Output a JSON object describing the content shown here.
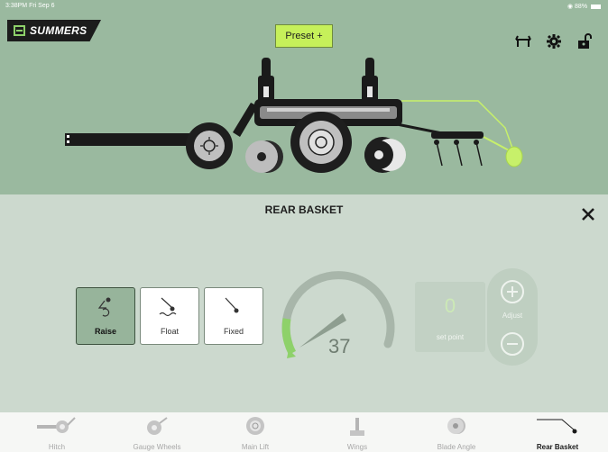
{
  "status_bar": {
    "time": "3:38PM  Fri Sep 6",
    "battery": "88%"
  },
  "header": {
    "brand": "SUMMERS",
    "preset_label": "Preset +"
  },
  "panel": {
    "title": "REAR BASKET",
    "modes": [
      {
        "label": "Raise",
        "active": true
      },
      {
        "label": "Float",
        "active": false
      },
      {
        "label": "Fixed",
        "active": false
      }
    ],
    "gauge_value": "37",
    "set_point_value": "0",
    "set_point_label": "set point",
    "adjust_label": "Adjust"
  },
  "nav": {
    "items": [
      {
        "label": "Hitch",
        "active": false
      },
      {
        "label": "Gauge Wheels",
        "active": false
      },
      {
        "label": "Main Lift",
        "active": false
      },
      {
        "label": "Wings",
        "active": false
      },
      {
        "label": "Blade Angle",
        "active": false
      },
      {
        "label": "Rear Basket",
        "active": true
      }
    ]
  },
  "colors": {
    "accent": "#8ed16a",
    "preset": "#c6f05a",
    "top_bg": "#9ab99f",
    "panel_bg": "#ccd9ce"
  }
}
